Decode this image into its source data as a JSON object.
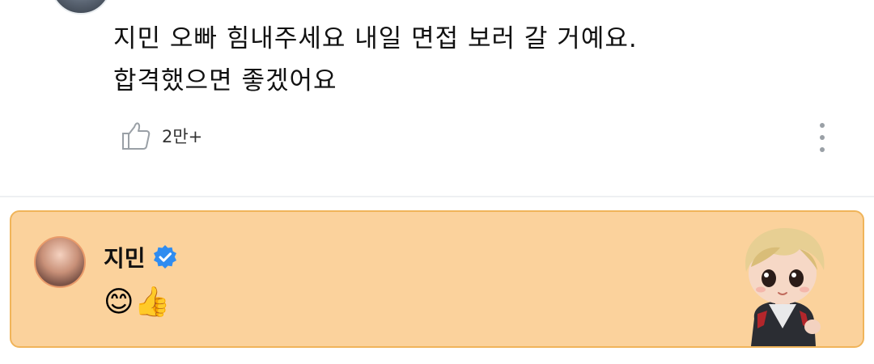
{
  "comment": {
    "text_line1": "지민 오빠 힘내주세요 내일 면접 보러 갈 거예요.",
    "text_line2": "합격했으면 좋겠어요",
    "like_count": "2만+",
    "like_icon": "thumbs-up-outline-icon",
    "more_icon": "vertical-ellipsis-icon"
  },
  "reply": {
    "author_name": "지민",
    "verified_icon": "verified-badge-icon",
    "message": "😊👍",
    "sticker": "character-sticker",
    "colors": {
      "card_background": "#fbd29c",
      "card_border": "#f0b45a",
      "verified_blue": "#2f8cf0"
    }
  }
}
